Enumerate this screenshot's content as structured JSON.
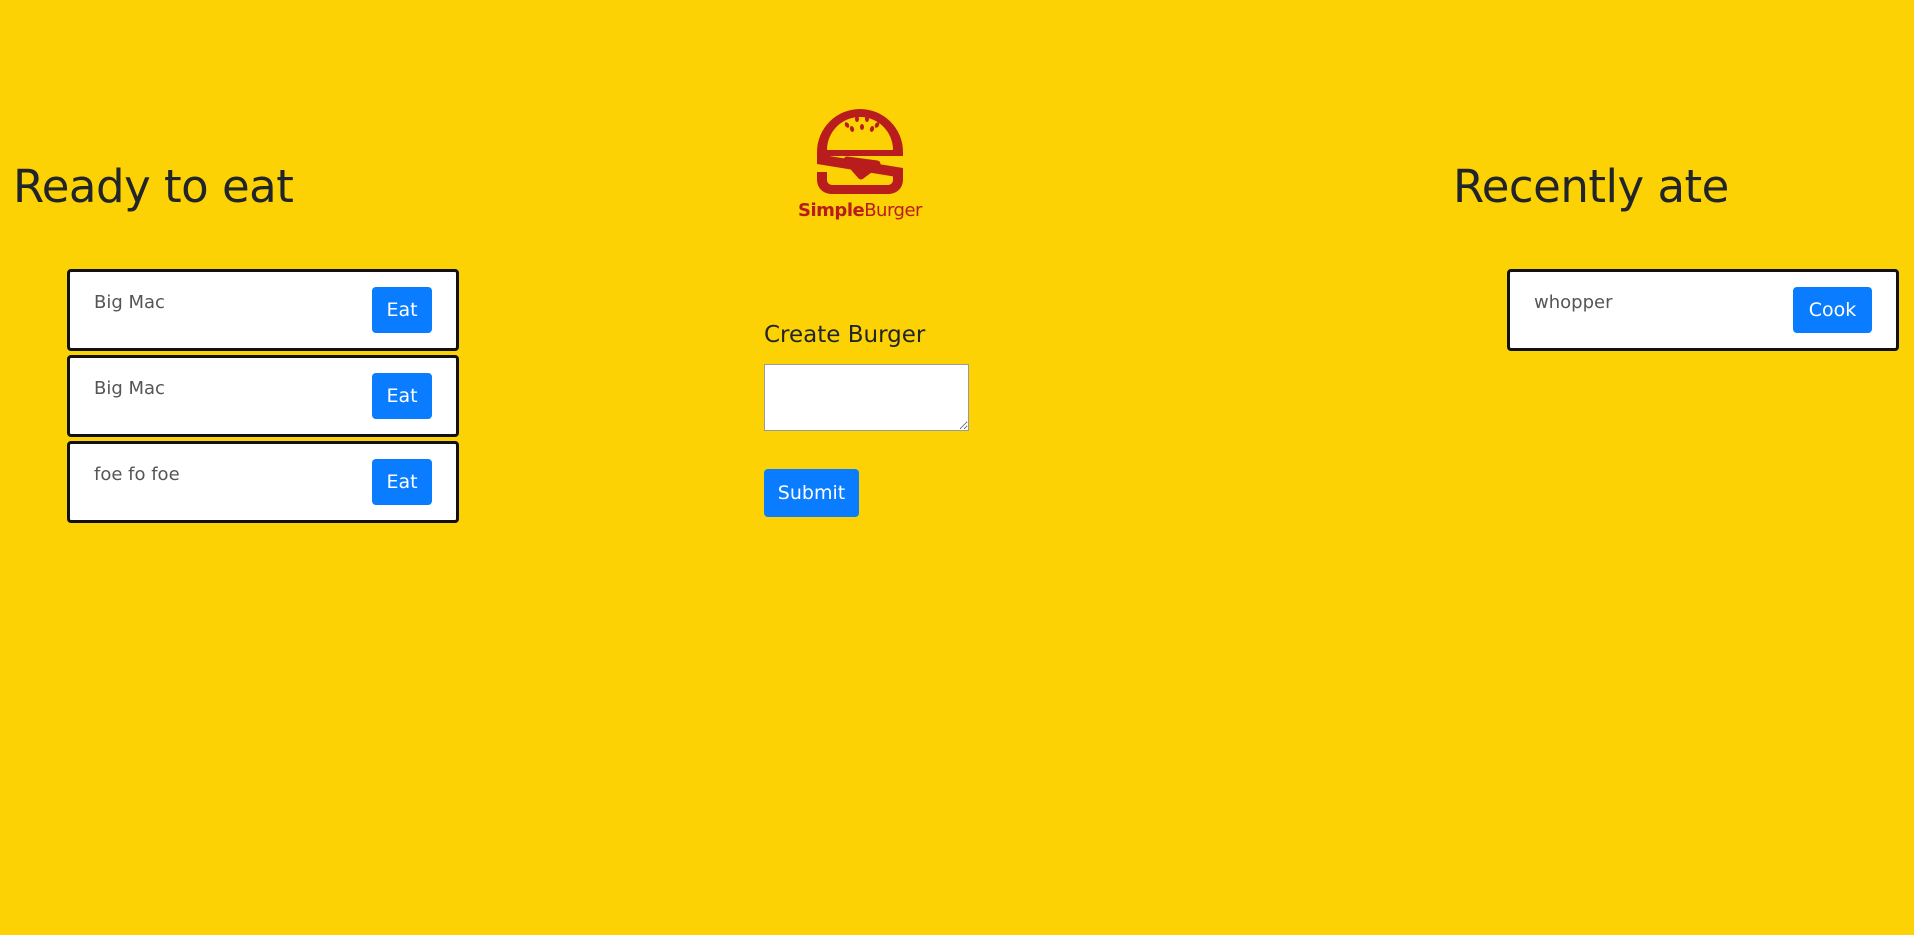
{
  "left_panel": {
    "heading": "Ready to eat",
    "burgers": [
      {
        "name": "Big Mac",
        "button": "Eat"
      },
      {
        "name": "Big Mac",
        "button": "Eat"
      },
      {
        "name": "foe fo foe",
        "button": "Eat"
      }
    ]
  },
  "right_panel": {
    "heading": "Recently ate",
    "burgers": [
      {
        "name": "whopper",
        "button": "Cook"
      }
    ]
  },
  "logo": {
    "text_bold": "Simple",
    "text_regular": "Burger",
    "icon": "burger-logo-icon"
  },
  "form": {
    "label": "Create Burger",
    "textarea_value": "",
    "submit_label": "Submit"
  },
  "colors": {
    "background": "#fcd205",
    "button": "#0a7cff",
    "logo": "#b91c1c"
  }
}
